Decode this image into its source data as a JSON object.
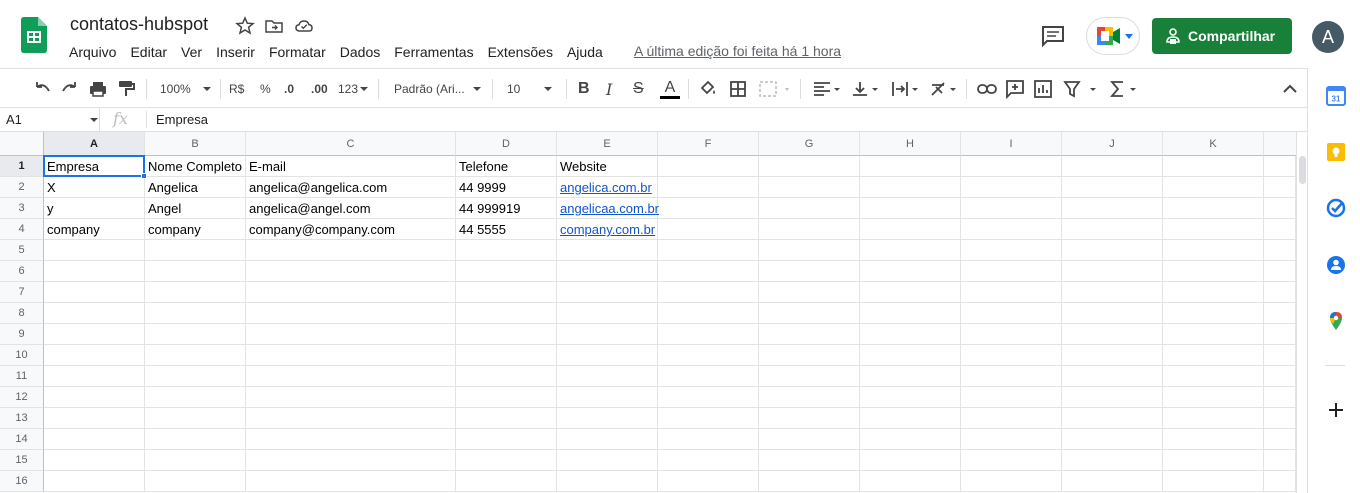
{
  "app": {
    "doc_title": "contatos-hubspot",
    "last_edit": "A última edição foi feita há 1 hora",
    "share_label": "Compartilhar",
    "avatar_letter": "A",
    "brand_color": "#188038",
    "accent_color": "#1a73e8"
  },
  "menu": [
    "Arquivo",
    "Editar",
    "Ver",
    "Inserir",
    "Formatar",
    "Dados",
    "Ferramentas",
    "Extensões",
    "Ajuda"
  ],
  "toolbar": {
    "zoom": "100%",
    "currency": "R$",
    "percent": "%",
    "dec_decrease": ".0",
    "dec_increase": ".00",
    "more_formats": "123",
    "font_family": "Padrão (Ari...",
    "font_size": "10"
  },
  "formula_bar": {
    "cell_ref": "A1",
    "fx_label": "fx",
    "value": "Empresa"
  },
  "grid": {
    "columns": [
      "A",
      "B",
      "C",
      "D",
      "E",
      "F",
      "G",
      "H",
      "I",
      "J",
      "K"
    ],
    "row_numbers": [
      "1",
      "2",
      "3",
      "4",
      "5",
      "6",
      "7",
      "8",
      "9",
      "10",
      "11",
      "12",
      "13",
      "14",
      "15",
      "16"
    ],
    "rows": [
      [
        "Empresa",
        "Nome Completo",
        "E-mail",
        "Telefone",
        "Website"
      ],
      [
        "X",
        "Angelica",
        "angelica@angelica.com",
        "44 9999",
        "angelica.com.br"
      ],
      [
        "y",
        "Angel",
        "angelica@angel.com",
        "44 999919",
        "angelicaa.com.br"
      ],
      [
        "company",
        "company",
        "company@company.com",
        "44 5555",
        "company.com.br"
      ]
    ],
    "selected_cell": "A1"
  },
  "side_panel": {
    "calendar_day": "31",
    "icons": [
      "calendar-icon",
      "keep-icon",
      "tasks-icon",
      "contacts-icon",
      "maps-icon",
      "add-icon"
    ]
  }
}
